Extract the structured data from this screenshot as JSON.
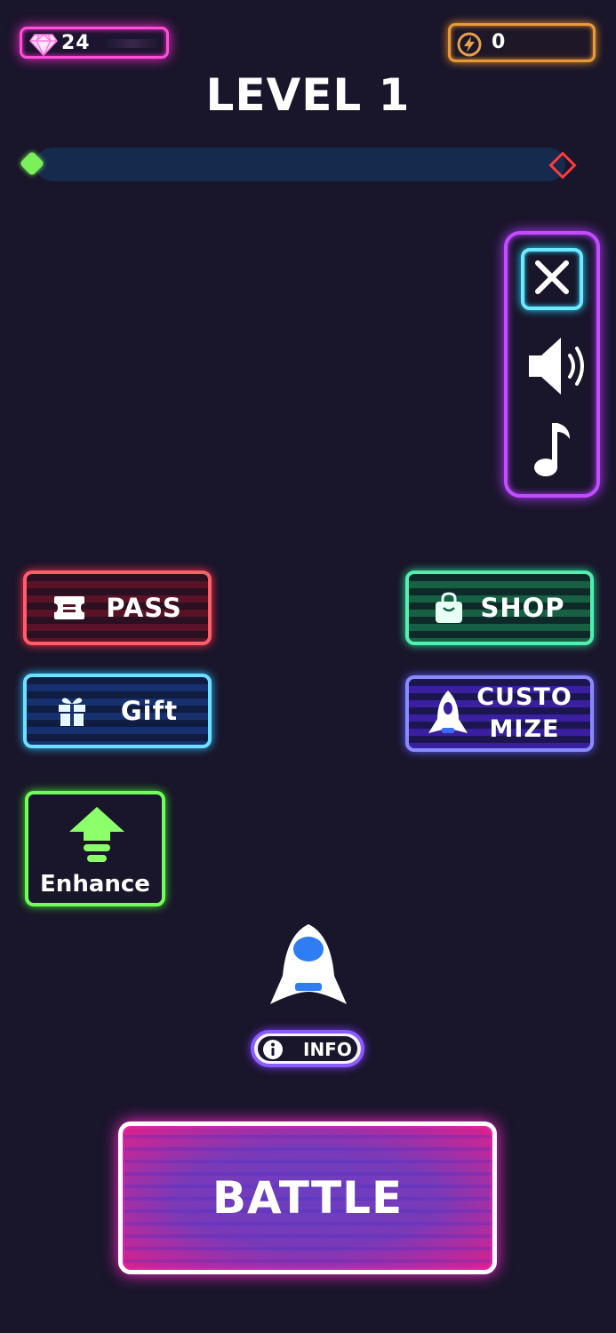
{
  "colors": {
    "background": "#19152a",
    "gem_border": "#ff4fd8",
    "energy_border": "#e79a3a",
    "progress_track": "#162a4d",
    "settings_border": "#c24cff",
    "pass": "#ff5d68",
    "shop": "#52f0b0",
    "gift": "#6ee0ff",
    "customize": "#8a8aff",
    "enhance": "#70ff58",
    "battle": "#e0208a"
  },
  "header": {
    "gems": "24",
    "energy": "0",
    "gem_icon": "diamond-icon",
    "energy_icon": "lightning-icon"
  },
  "level": {
    "title": "LEVEL 1",
    "progress": 0
  },
  "settings": {
    "close_icon": "close-icon",
    "sound_icon": "speaker-icon",
    "music_icon": "music-note-icon"
  },
  "menu": {
    "pass": "PASS",
    "shop": "SHOP",
    "gift": "Gift",
    "customize_line1": "CUSTO",
    "customize_line2": "MIZE",
    "enhance": "Enhance"
  },
  "info": {
    "label": "INFO"
  },
  "battle": {
    "label": "BATTLE"
  }
}
